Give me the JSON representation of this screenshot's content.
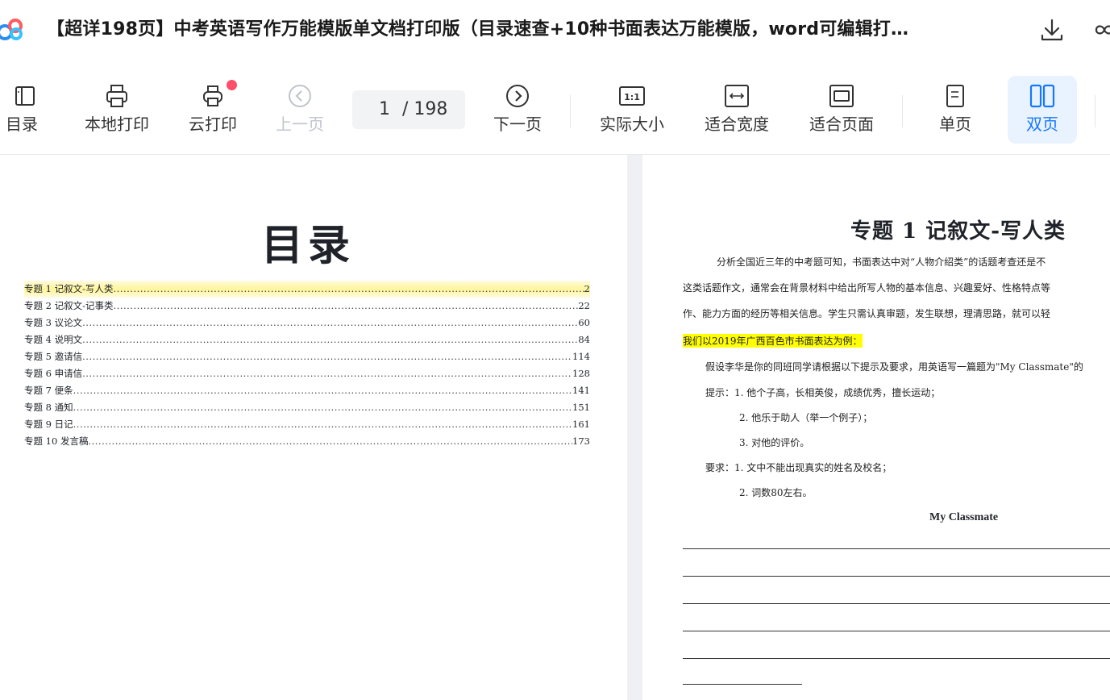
{
  "titlebar": {
    "title": "【超详198页】中考英语写作万能模版单文档打印版（目录速查+10种书面表达万能模版，word可编辑打…"
  },
  "toolbar": {
    "items": [
      {
        "label": "目录",
        "icon": "sidebar-toc-icon"
      },
      {
        "label": "本地打印",
        "icon": "printer-icon"
      },
      {
        "label": "云打印",
        "icon": "cloud-printer-icon"
      },
      {
        "label": "上一页",
        "icon": "chevron-left-circle-icon"
      },
      {
        "label": "下一页",
        "icon": "chevron-right-circle-icon"
      },
      {
        "label": "实际大小",
        "icon": "actual-size-icon"
      },
      {
        "label": "适合宽度",
        "icon": "fit-width-icon"
      },
      {
        "label": "适合页面",
        "icon": "fit-page-icon"
      },
      {
        "label": "单页",
        "icon": "single-page-icon"
      },
      {
        "label": "双页",
        "icon": "double-page-icon"
      }
    ],
    "page": {
      "current": "1",
      "total": "/ 198"
    }
  },
  "left_page": {
    "title": "目录",
    "toc": [
      {
        "label": "专题 1  记叙文-写人类",
        "page": "2"
      },
      {
        "label": "专题 2  记叙文-记事类",
        "page": "22"
      },
      {
        "label": "专题 3  议论文",
        "page": "60"
      },
      {
        "label": "专题 4  说明文",
        "page": "84"
      },
      {
        "label": "专题 5  邀请信",
        "page": "114"
      },
      {
        "label": "专题 6  申请信",
        "page": "128"
      },
      {
        "label": "专题 7  便条",
        "page": "141"
      },
      {
        "label": "专题 8  通知",
        "page": "151"
      },
      {
        "label": "专题 9  日记",
        "page": "161"
      },
      {
        "label": "专题 10  发言稿",
        "page": "173"
      }
    ]
  },
  "right_page": {
    "title": "专题 1  记叙文-写人类",
    "p1": "分析全国近三年的中考题可知，书面表达中对“人物介绍类”的话题考查还是不",
    "p2": "这类话题作文，通常会在背景材料中给出所写人物的基本信息、兴趣爱好、性格特点等",
    "p3": "作、能力方面的经历等相关信息。学生只需认真审题，发生联想，理清思路，就可以轻",
    "example": "我们以2019年广西百色市书面表达为例：",
    "prompt": "假设李华是你的同班同学请根据以下提示及要求，用英语写一篇题为\"My Classmate\"的",
    "hint1": "提示：1. 他个子高，长相英俊，成绩优秀，擅长运动；",
    "hint2": "2. 他乐于助人（举一个例子）；",
    "hint3": "3. 对他的评价。",
    "req1": "要求：1. 文中不能出现真实的姓名及校名；",
    "req2": "2. 词数80左右。",
    "essay_title": "My Classmate"
  },
  "colors": {
    "accent": "#1677ff",
    "badge": "#ff4d6a",
    "highlight": "#ffff00"
  }
}
